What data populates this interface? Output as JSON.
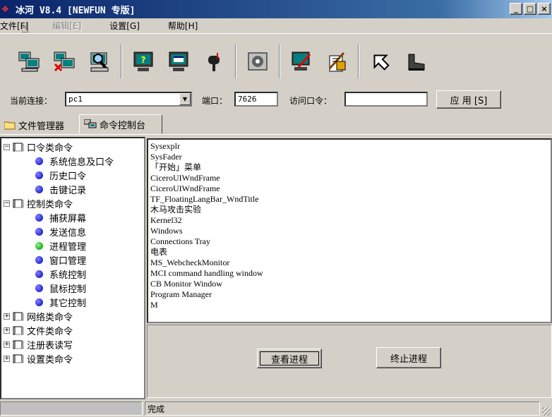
{
  "window": {
    "title": "冰河 V8.4 [NEWFUN 专版]",
    "title_icon": "ice-river-icon",
    "controls": [
      "_",
      "□",
      "×"
    ]
  },
  "menu": {
    "items": [
      {
        "label": "文件[F]",
        "enabled": true
      },
      {
        "label": "编辑[E]",
        "enabled": false
      },
      {
        "label": "设置[G]",
        "enabled": true
      },
      {
        "label": "帮助[H]",
        "enabled": true
      }
    ]
  },
  "toolbar": {
    "buttons": [
      "add-host-icon",
      "delete-host-icon",
      "search-host-icon",
      "help-monitor-icon",
      "screen-icon",
      "mailbox-icon",
      "config-disk-icon",
      "edit-monitor-icon",
      "tools-icon",
      "up-arrow-icon",
      "boot-icon"
    ]
  },
  "connection": {
    "current_label": "当前连接：",
    "current_value": "pc1",
    "port_label": "端口：",
    "port_value": "7626",
    "password_label": "访问口令：",
    "password_value": "",
    "apply_label": "应 用 [S]"
  },
  "tabs": [
    {
      "label": "文件管理器",
      "active": false
    },
    {
      "label": "命令控制台",
      "active": true
    }
  ],
  "tree": {
    "nodes": [
      {
        "label": "口令类命令",
        "level": 0,
        "expanded": true
      },
      {
        "label": "系统信息及口令",
        "level": 1,
        "color": "#0000c0"
      },
      {
        "label": "历史口令",
        "level": 1,
        "color": "#0000c0"
      },
      {
        "label": "击键记录",
        "level": 1,
        "color": "#0000c0"
      },
      {
        "label": "控制类命令",
        "level": 0,
        "expanded": true
      },
      {
        "label": "捕获屏幕",
        "level": 1,
        "color": "#0000c0"
      },
      {
        "label": "发送信息",
        "level": 1,
        "color": "#0000c0"
      },
      {
        "label": "进程管理",
        "level": 1,
        "color": "#20a020"
      },
      {
        "label": "窗口管理",
        "level": 1,
        "color": "#0000c0"
      },
      {
        "label": "系统控制",
        "level": 1,
        "color": "#0000c0"
      },
      {
        "label": "鼠标控制",
        "level": 1,
        "color": "#0000c0"
      },
      {
        "label": "其它控制",
        "level": 1,
        "color": "#0000c0"
      },
      {
        "label": "网络类命令",
        "level": 0,
        "expanded": false
      },
      {
        "label": "文件类命令",
        "level": 0,
        "expanded": false
      },
      {
        "label": "注册表读写",
        "level": 0,
        "expanded": false
      },
      {
        "label": "设置类命令",
        "level": 0,
        "expanded": false
      }
    ]
  },
  "output": {
    "lines": [
      "Sysexplr",
      "SysFader",
      "「开始」菜单",
      "CiceroUIWndFrame",
      "CiceroUIWndFrame",
      "TF_FloatingLangBar_WndTitle",
      "木马攻击实验",
      "Kernel32",
      "Windows",
      "Connections Tray",
      "电表",
      "MS_WebcheckMonitor",
      "MCI command handling window",
      "CB Monitor Window",
      "Program Manager",
      "M"
    ]
  },
  "actions": {
    "view_process": "查看进程",
    "kill_process": "终止进程"
  },
  "status": {
    "text": "完成"
  }
}
